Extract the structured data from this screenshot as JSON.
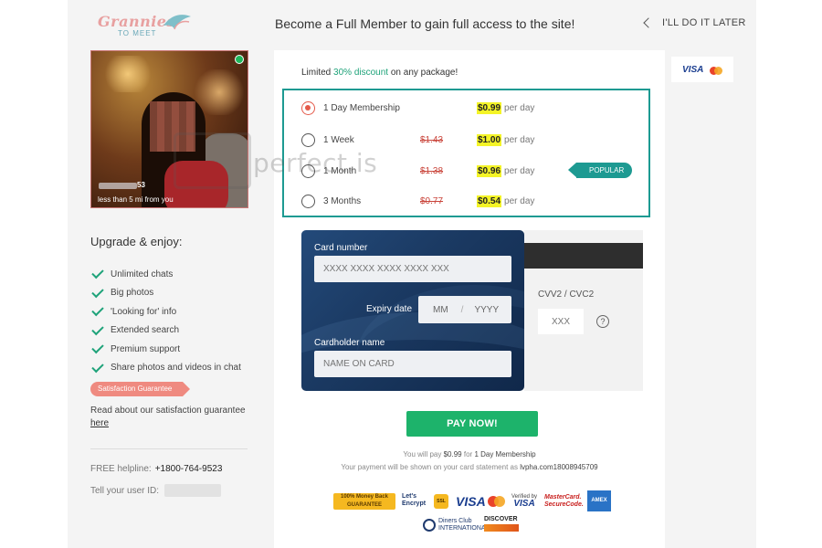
{
  "brand": {
    "line1": "Grannies",
    "line2": "TO MEET"
  },
  "header": {
    "headline": "Become a Full Member to gain full access to the site!",
    "later_label": "I'LL DO IT LATER"
  },
  "profile": {
    "age": "53",
    "distance": "less than 5 mi from you"
  },
  "upgrade": {
    "title": "Upgrade & enjoy:",
    "features": [
      "Unlimited chats",
      "Big photos",
      "'Looking for' info",
      "Extended search",
      "Premium support",
      "Share photos and videos in chat"
    ],
    "guarantee_tag": "Satisfaction Guarantee",
    "guarantee_text": "Read about our satisfaction guarantee",
    "guarantee_link": "here"
  },
  "support": {
    "helpline_label": "FREE helpline:",
    "helpline_number": "+1800-764-9523",
    "userid_label": "Tell your user ID:"
  },
  "card_brands": {
    "visa": "VISA"
  },
  "promo": {
    "prefix": "Limited",
    "discount": "30% discount",
    "suffix": "on any package!"
  },
  "packages": [
    {
      "name": "1 Day Membership",
      "old_price": "",
      "price": "$0.99",
      "per": "per day",
      "selected": true
    },
    {
      "name": "1 Week",
      "old_price": "$1.43",
      "price": "$1.00",
      "per": "per day",
      "selected": false
    },
    {
      "name": "1 Month",
      "old_price": "$1.38",
      "price": "$0.96",
      "per": "per day",
      "selected": false
    },
    {
      "name": "3 Months",
      "old_price": "$0.77",
      "price": "$0.54",
      "per": "per day",
      "selected": false
    }
  ],
  "popular_label": "POPULAR",
  "payment_form": {
    "card_number_label": "Card number",
    "card_number_placeholder": "XXXX XXXX XXXX XXXX XXX",
    "expiry_label": "Expiry date",
    "expiry_month_placeholder": "MM",
    "expiry_separator": "/",
    "expiry_year_placeholder": "YYYY",
    "holder_label": "Cardholder name",
    "holder_placeholder": "NAME ON CARD",
    "cvv_label": "CVV2 / CVC2",
    "cvv_placeholder": "XXX",
    "help_icon": "?"
  },
  "pay_button": "PAY NOW!",
  "summary": {
    "pay_prefix": "You will pay",
    "pay_amount": "$0.99",
    "pay_for": "for",
    "pay_package": "1 Day Membership",
    "statement_prefix": "Your payment will be shown on your card statement as",
    "statement_descriptor": "lvpha.com18008945709"
  },
  "trust_badges": {
    "guarantee": "100% Money Back GUARANTEE",
    "letsencrypt": "Let's Encrypt",
    "ssl": "SSL",
    "visa": "VISA",
    "verified_visa_top": "Verified by",
    "verified_visa": "VISA",
    "mastercard_secure": "MasterCard. SecureCode.",
    "amex": "AMEX",
    "diners": "Diners Club INTERNATIONAL",
    "discover": "DISCOVER"
  },
  "watermark": "perfect.is",
  "colors": {
    "accent": "#1d9a92",
    "pay": "#1db36b",
    "highlight": "#f4f427",
    "strike": "#c9443a",
    "selected_radio": "#e45a4a",
    "tag": "#ef8a80"
  }
}
